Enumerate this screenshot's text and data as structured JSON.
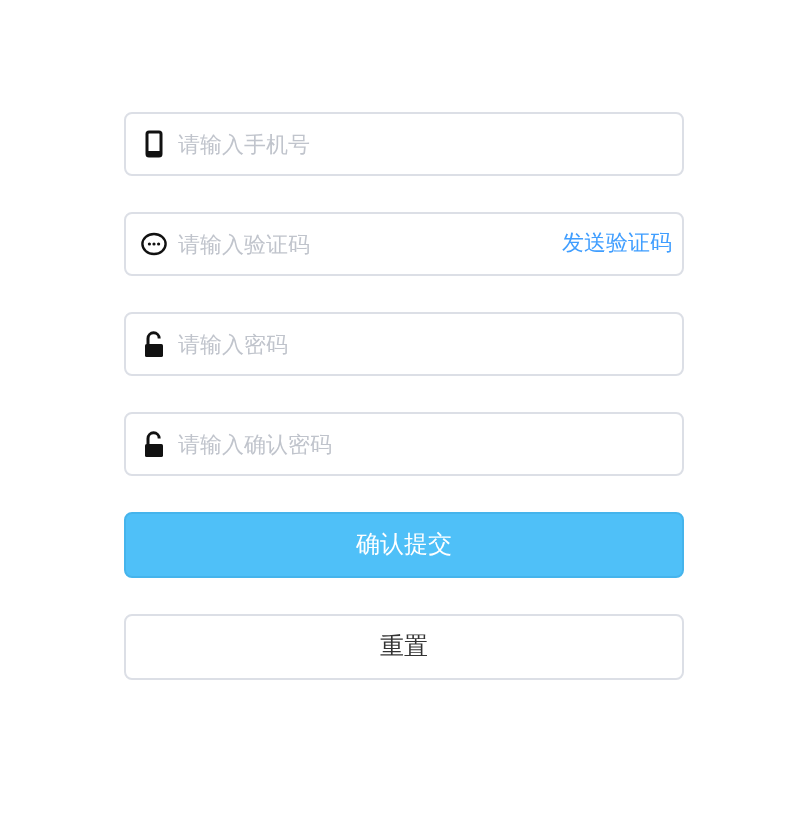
{
  "fields": [
    {
      "kind": "phone",
      "placeholder": "请输入手机号"
    },
    {
      "kind": "chat",
      "placeholder": "请输入验证码",
      "action": "发送验证码"
    },
    {
      "kind": "lock",
      "placeholder": "请输入密码"
    },
    {
      "kind": "lock",
      "placeholder": "请输入确认密码"
    }
  ],
  "buttons": [
    {
      "label": "确认提交",
      "kind": "primary"
    },
    {
      "label": "重置",
      "kind": "plain"
    }
  ]
}
